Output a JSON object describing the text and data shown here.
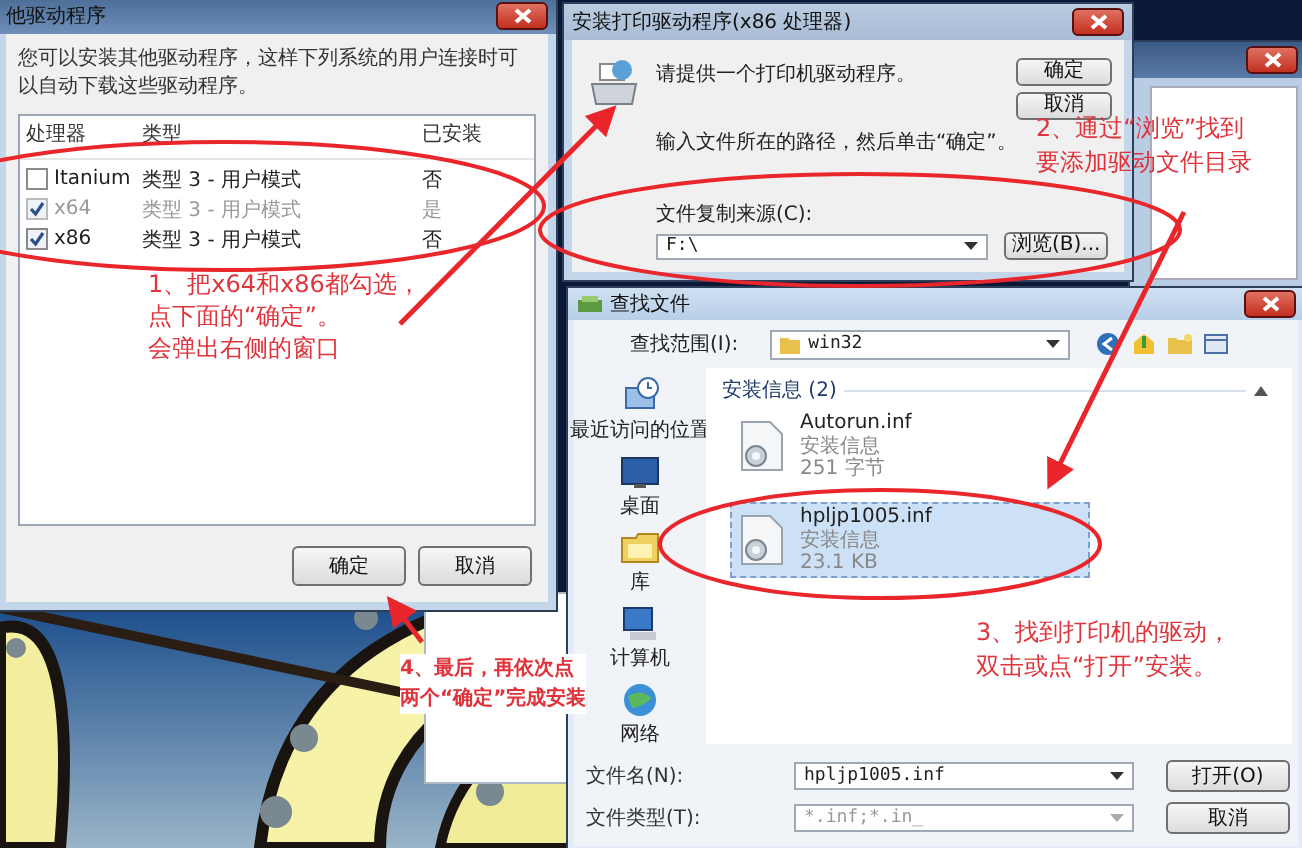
{
  "driver_window": {
    "title": "他驱动程序",
    "description": "您可以安装其他驱动程序，这样下列系统的用户连接时可以自动下载这些驱动程序。",
    "columns": [
      "处理器",
      "类型",
      "已安装"
    ],
    "rows": [
      {
        "cells": [
          "Itanium",
          "类型 3 - 用户模式",
          "否"
        ],
        "checked": false,
        "disabled": false
      },
      {
        "cells": [
          "x64",
          "类型 3 - 用户模式",
          "是"
        ],
        "checked": true,
        "disabled": true
      },
      {
        "cells": [
          "x86",
          "类型 3 - 用户模式",
          "否"
        ],
        "checked": true,
        "disabled": false
      }
    ],
    "buttons": [
      "确定",
      "取消"
    ]
  },
  "install_dialog": {
    "title": "安装打印驱动程序(x86 处理器)",
    "prompt": "请提供一个打印机驱动程序。",
    "instruction": "输入文件所在的路径，然后单击“确定”。",
    "buttons": [
      "确定",
      "取消"
    ],
    "source_label": "文件复制来源(C):",
    "source_value": "F:\\",
    "browse_button": "浏览(B)..."
  },
  "find_file_dialog": {
    "title": "查找文件",
    "look_in_label": "查找范围(I):",
    "look_in_value": "win32",
    "places": [
      {
        "label": "最近访问的位置",
        "kind": "recent"
      },
      {
        "label": "桌面",
        "kind": "desktop"
      },
      {
        "label": "库",
        "kind": "library"
      },
      {
        "label": "计算机",
        "kind": "computer"
      },
      {
        "label": "网络",
        "kind": "network"
      }
    ],
    "group": "安装信息 (2)",
    "files": [
      {
        "name": "Autorun.inf",
        "type": "安装信息",
        "size": "251 字节",
        "selected": false
      },
      {
        "name": "hpljp1005.inf",
        "type": "安装信息",
        "size": "23.1 KB",
        "selected": true
      }
    ],
    "file_name_label": "文件名(N):",
    "file_name_value": "hpljp1005.inf",
    "file_type_label": "文件类型(T):",
    "file_type_value": "*.inf;*.in_",
    "buttons": [
      "打开(O)",
      "取消"
    ]
  },
  "annotations": [
    {
      "lines": [
        "1、把x64和x86都勾选，",
        "点下面的“确定”。",
        "会弹出右侧的窗口"
      ]
    },
    {
      "lines": [
        "2、通过“浏览”找到",
        "要添加驱动文件目录"
      ]
    },
    {
      "lines": [
        "3、找到打印机的驱动，",
        "双击或点“打开”安装。"
      ]
    },
    {
      "lines": [
        "4、最后，再依次点",
        "两个“确定”完成安装"
      ]
    }
  ]
}
